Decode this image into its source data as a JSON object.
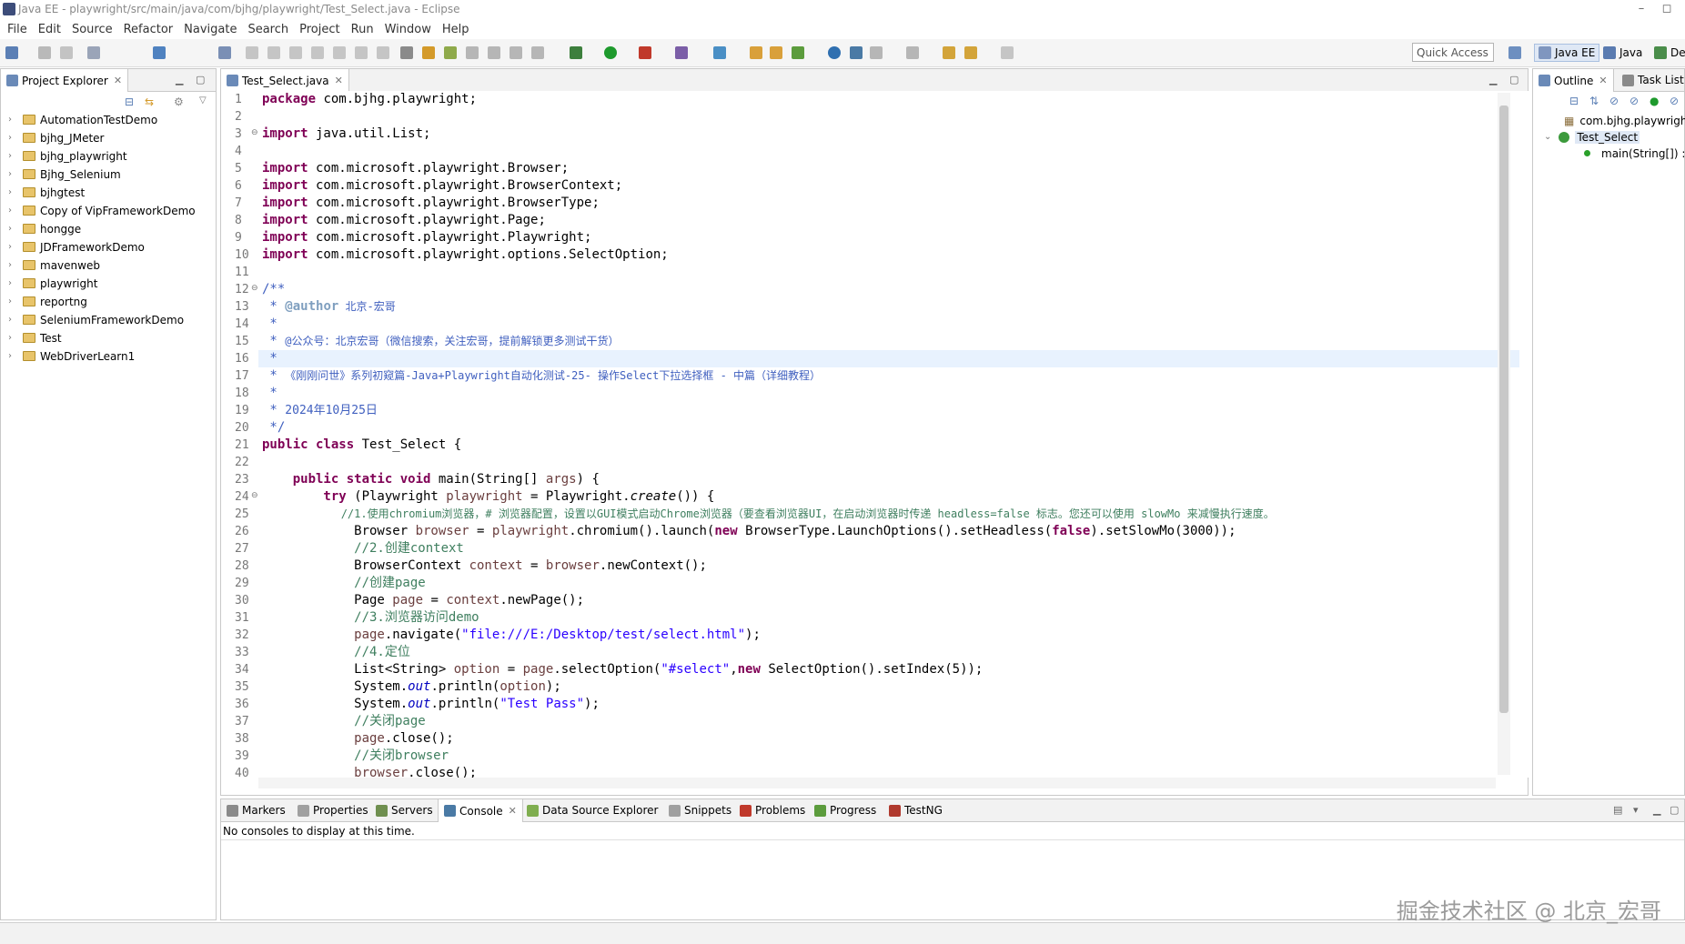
{
  "window": {
    "title": "Java EE - playwright/src/main/java/com/bjhg/playwright/Test_Select.java - Eclipse",
    "controls": [
      "–",
      "◻"
    ]
  },
  "menu": [
    "File",
    "Edit",
    "Source",
    "Refactor",
    "Navigate",
    "Search",
    "Project",
    "Run",
    "Window",
    "Help"
  ],
  "toolbar": {
    "quick_access": "Quick Access",
    "perspectives": [
      {
        "label": "Java EE",
        "active": true
      },
      {
        "label": "Java",
        "active": false
      },
      {
        "label": "De",
        "active": false
      }
    ]
  },
  "project_explorer": {
    "tab_label": "Project Explorer",
    "items": [
      "AutomationTestDemo",
      "bjhg_JMeter",
      "bjhg_playwright",
      "Bjhg_Selenium",
      "bjhgtest",
      "Copy of VipFrameworkDemo",
      "hongge",
      "JDFrameworkDemo",
      "mavenweb",
      "playwright",
      "reportng",
      "SeleniumFrameworkDemo",
      "Test",
      "WebDriverLearn1"
    ]
  },
  "editor": {
    "tab_label": "Test_Select.java",
    "line_numbers": [
      "1",
      "2",
      "3",
      "4",
      "5",
      "6",
      "7",
      "8",
      "9",
      "10",
      "11",
      "12",
      "13",
      "14",
      "15",
      "16",
      "17",
      "18",
      "19",
      "20",
      "21",
      "22",
      "23",
      "24",
      "25",
      "26",
      "27",
      "28",
      "29",
      "30",
      "31",
      "32",
      "33",
      "34",
      "35",
      "36",
      "37",
      "38",
      "39",
      "40"
    ],
    "lines": {
      "l1_kw": "package",
      "l1_rest": " com.bjhg.playwright;",
      "l3_kw": "import",
      "l3_rest": " java.util.List;",
      "l5_rest": " com.microsoft.playwright.Browser;",
      "l6_rest": " com.microsoft.playwright.BrowserContext;",
      "l7_rest": " com.microsoft.playwright.BrowserType;",
      "l8_rest": " com.microsoft.playwright.Page;",
      "l9_rest": " com.microsoft.playwright.Playwright;",
      "l10_rest": " com.microsoft.playwright.options.SelectOption;",
      "l12": "/**",
      "l13_star": " * ",
      "l13_tag": "@author",
      "l13_rest": " 北京-宏哥",
      "l14": " *",
      "l15_star": " * ",
      "l15_rest": "@公众号：北京宏哥（微信搜索，关注宏哥，提前解锁更多测试干货）",
      "l16": " *",
      "l17_star": " * ",
      "l17_rest": "《刚刚问世》系列初窥篇-Java+Playwright自动化测试-25- 操作Select下拉选择框 - 中篇（详细教程）",
      "l18": " *",
      "l19_star": " * ",
      "l19_rest": "2024年10月25日",
      "l20": " */",
      "l21_kw": "public class",
      "l21_rest": " Test_Select {",
      "l23_kw": "    public static void",
      "l23_rest": " main(String[] ",
      "l23_var": "args",
      "l23_end": ") {",
      "l24_kw": "        try",
      "l24_a": " (Playwright ",
      "l24_var": "playwright",
      "l24_b": " = Playwright.",
      "l24_it": "create",
      "l24_c": "()) {",
      "l25": "            //1.使用chromium浏览器，# 浏览器配置，设置以GUI模式启动Chrome浏览器（要查看浏览器UI，在启动浏览器时传递 headless=false 标志。您还可以使用 slowMo 来减慢执行速度。",
      "l26_a": "            Browser ",
      "l26_var": "browser",
      "l26_b": " = ",
      "l26_var2": "playwright",
      "l26_c": ".chromium().launch(",
      "l26_kw": "new",
      "l26_d": " BrowserType.LaunchOptions().setHeadless(",
      "l26_kw2": "false",
      "l26_e": ").setSlowMo(3000));",
      "l27": "            //2.创建context",
      "l28_a": "            BrowserContext ",
      "l28_var": "context",
      "l28_b": " = ",
      "l28_var2": "browser",
      "l28_c": ".newContext();",
      "l29": "            //创建page",
      "l30_a": "            Page ",
      "l30_var": "page",
      "l30_b": " = ",
      "l30_var2": "context",
      "l30_c": ".newPage();",
      "l31": "            //3.浏览器访问demo",
      "l32_var": "            page",
      "l32_a": ".navigate(",
      "l32_str": "\"file:///E:/Desktop/test/select.html\"",
      "l32_b": ");",
      "l33": "            //4.定位",
      "l34_a": "            List<String> ",
      "l34_var": "option",
      "l34_b": " = ",
      "l34_var2": "page",
      "l34_c": ".selectOption(",
      "l34_str": "\"#select\"",
      "l34_d": ",",
      "l34_kw": "new",
      "l34_e": " SelectOption().setIndex(5));",
      "l35_a": "            System.",
      "l35_fd": "out",
      "l35_b": ".println(",
      "l35_var": "option",
      "l35_c": ");",
      "l36_a": "            System.",
      "l36_fd": "out",
      "l36_b": ".println(",
      "l36_str": "\"Test Pass\"",
      "l36_c": ");",
      "l37": "            //关闭page",
      "l38_var": "            page",
      "l38_a": ".close();",
      "l39": "            //关闭browser",
      "l40_var": "            browser",
      "l40_a": ".close();"
    }
  },
  "outline": {
    "tabs": [
      "Outline",
      "Task List"
    ],
    "items": [
      "com.bjhg.playwrigh",
      "Test_Select",
      "main(String[]) :"
    ]
  },
  "bottom_panel": {
    "tabs": [
      "Markers",
      "Properties",
      "Servers",
      "Console",
      "Data Source Explorer",
      "Snippets",
      "Problems",
      "Progress",
      "TestNG"
    ],
    "message": "No consoles to display at this time."
  },
  "watermark": "掘金技术社区 @ 北京_宏哥",
  "colors": {
    "keyword": "#7f0055",
    "comment": "#3f7f5f",
    "javadoc": "#3f5fbf",
    "string": "#2a00ff",
    "variable": "#6a3e3e",
    "field": "#0000c0"
  }
}
